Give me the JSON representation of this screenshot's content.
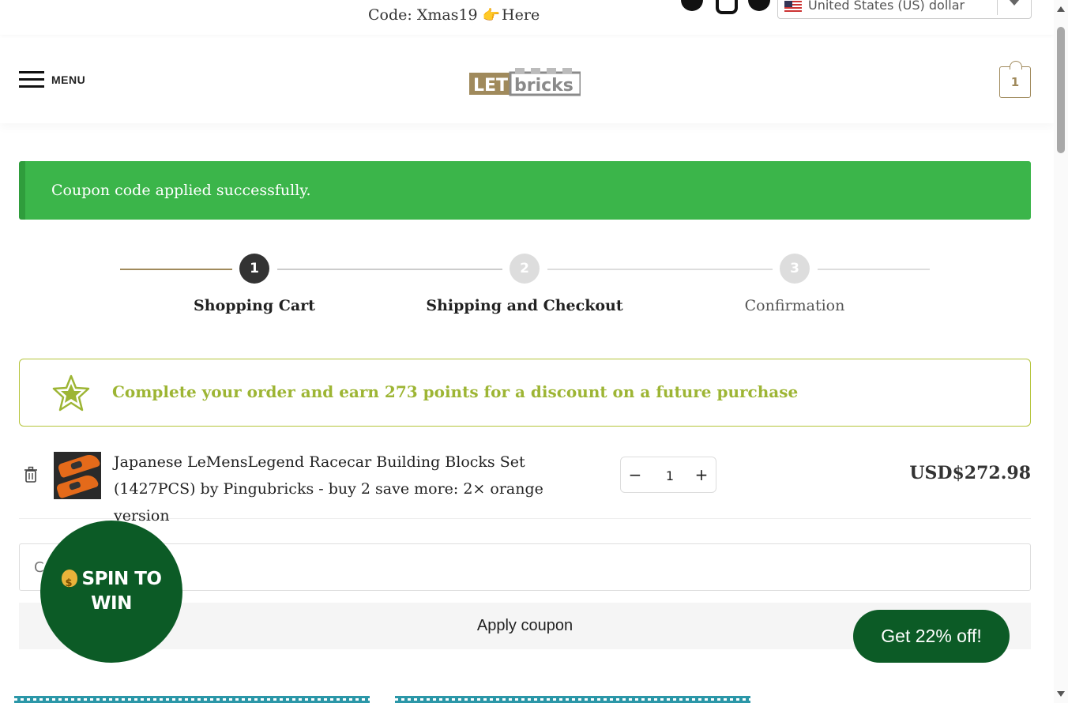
{
  "topbar": {
    "promo_code": "Code: Xmas19",
    "promo_link": "Here",
    "currency": "United States (US) dollar"
  },
  "header": {
    "menu_label": "MENU",
    "logo_left": "LET",
    "logo_right": "bricks",
    "cart_count": "1"
  },
  "alert": {
    "message": "Coupon code applied successfully."
  },
  "steps": [
    {
      "number": "1",
      "label": "Shopping Cart"
    },
    {
      "number": "2",
      "label": "Shipping and Checkout"
    },
    {
      "number": "3",
      "label": "Confirmation"
    }
  ],
  "points": {
    "message": "Complete your order and earn 273 points for a discount on a future purchase"
  },
  "cart": {
    "items": [
      {
        "name": "Japanese LeMensLegend Racecar Building Blocks Set (1427PCS) by Pingubricks - buy 2 save more: 2× orange version",
        "quantity": "1",
        "price": "USD$272.98"
      }
    ]
  },
  "coupon": {
    "placeholder": "Coupon code",
    "apply_label": "Apply coupon"
  },
  "popups": {
    "spin_line1": "SPIN TO",
    "spin_line2": "WIN",
    "discount": "Get 22% off!"
  },
  "colors": {
    "accent": "#a08a5c",
    "success": "#3bb54a",
    "points": "#9db534",
    "popup": "#0c5b26"
  }
}
